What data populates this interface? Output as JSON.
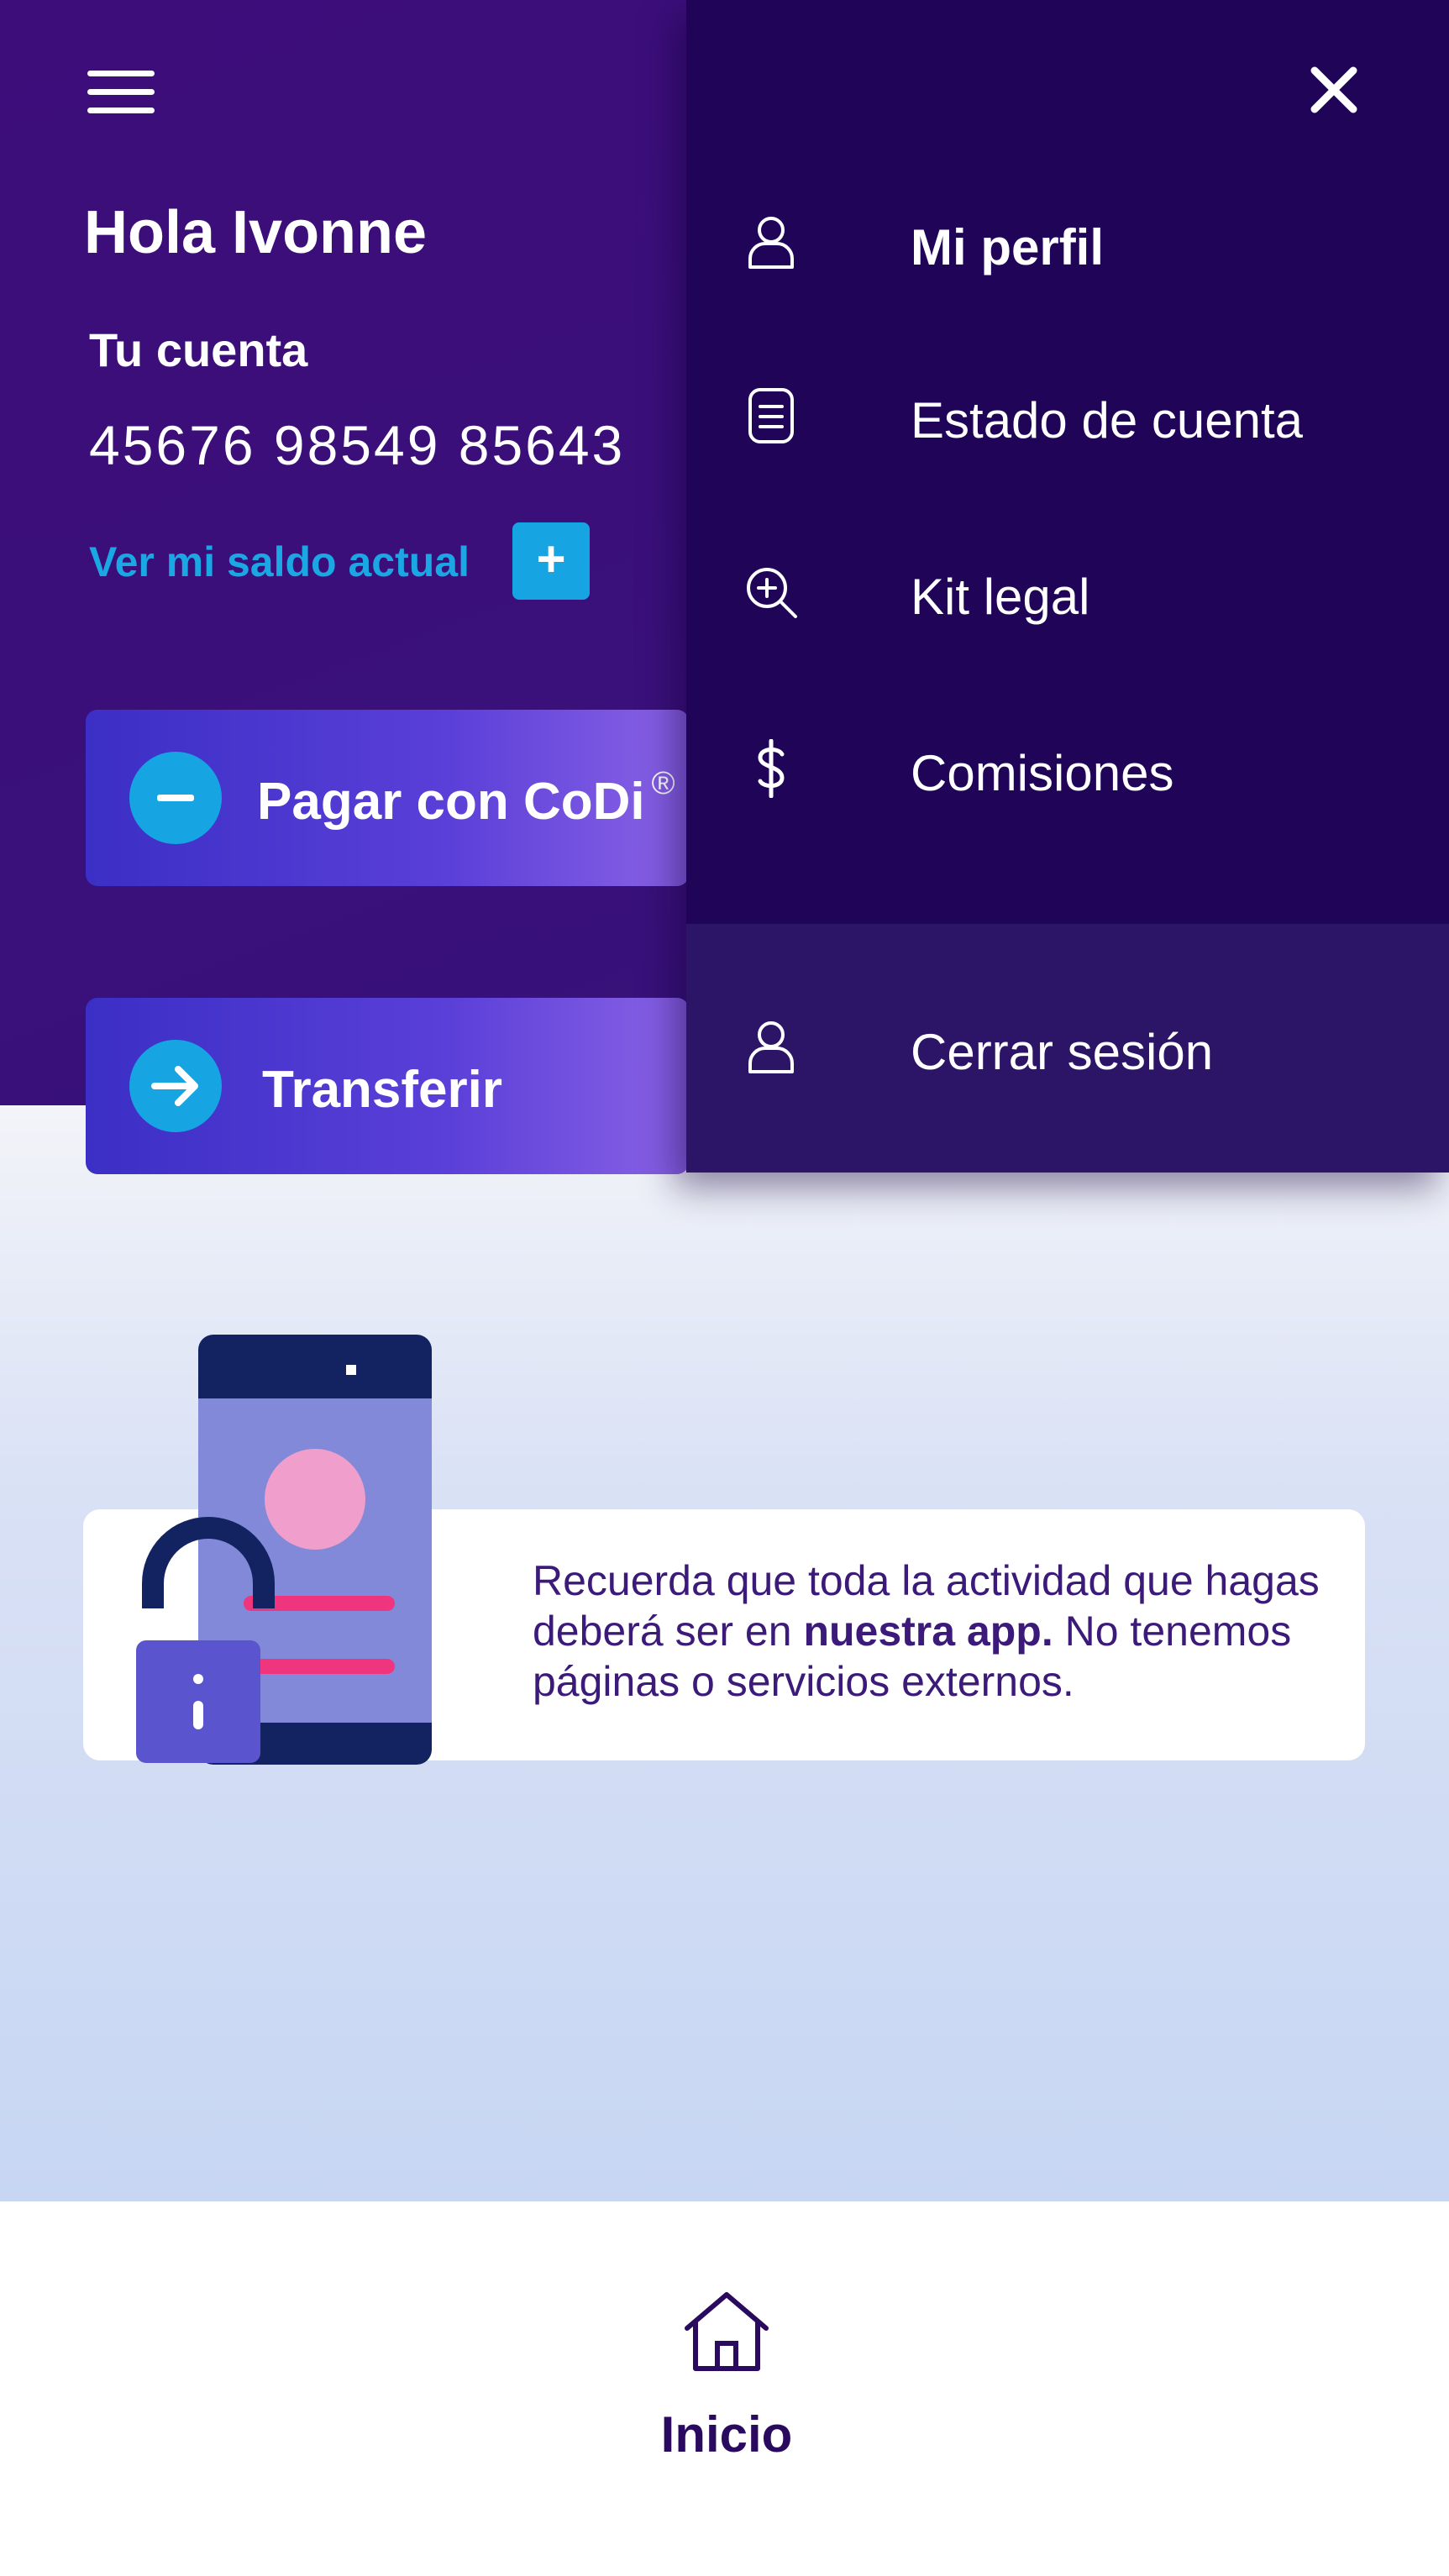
{
  "header": {
    "greeting": "Hola Ivonne",
    "account_label": "Tu cuenta",
    "account_number": "45676 98549 85643",
    "balance_link": "Ver mi saldo actual",
    "balance_plus": "+"
  },
  "actions": {
    "pay_label": "Pagar con CoDi",
    "pay_mark": "®",
    "transfer_label": "Transferir"
  },
  "notice": {
    "text_before": "Recuerda que toda la actividad que hagas deberá ser en ",
    "text_bold": "nuestra app.",
    "text_after": " No tenemos páginas o servicios externos."
  },
  "drawer": {
    "items": [
      {
        "label": "Mi perfil",
        "icon": "user-icon"
      },
      {
        "label": "Estado de cuenta",
        "icon": "document-icon"
      },
      {
        "label": "Kit legal",
        "icon": "zoom-in-icon"
      },
      {
        "label": "Comisiones",
        "icon": "dollar-icon"
      }
    ],
    "logout": {
      "label": "Cerrar sesión",
      "icon": "user-icon"
    },
    "close_icon": "close-icon"
  },
  "bottom_nav": {
    "home_label": "Inicio",
    "home_icon": "home-icon"
  },
  "colors": {
    "header_purple": "#3d0d7a",
    "drawer_bg": "#1f0458",
    "drawer_footer_bg": "#2c1467",
    "accent_blue": "#16a4e3",
    "text_dark_purple": "#3b1a7a"
  }
}
